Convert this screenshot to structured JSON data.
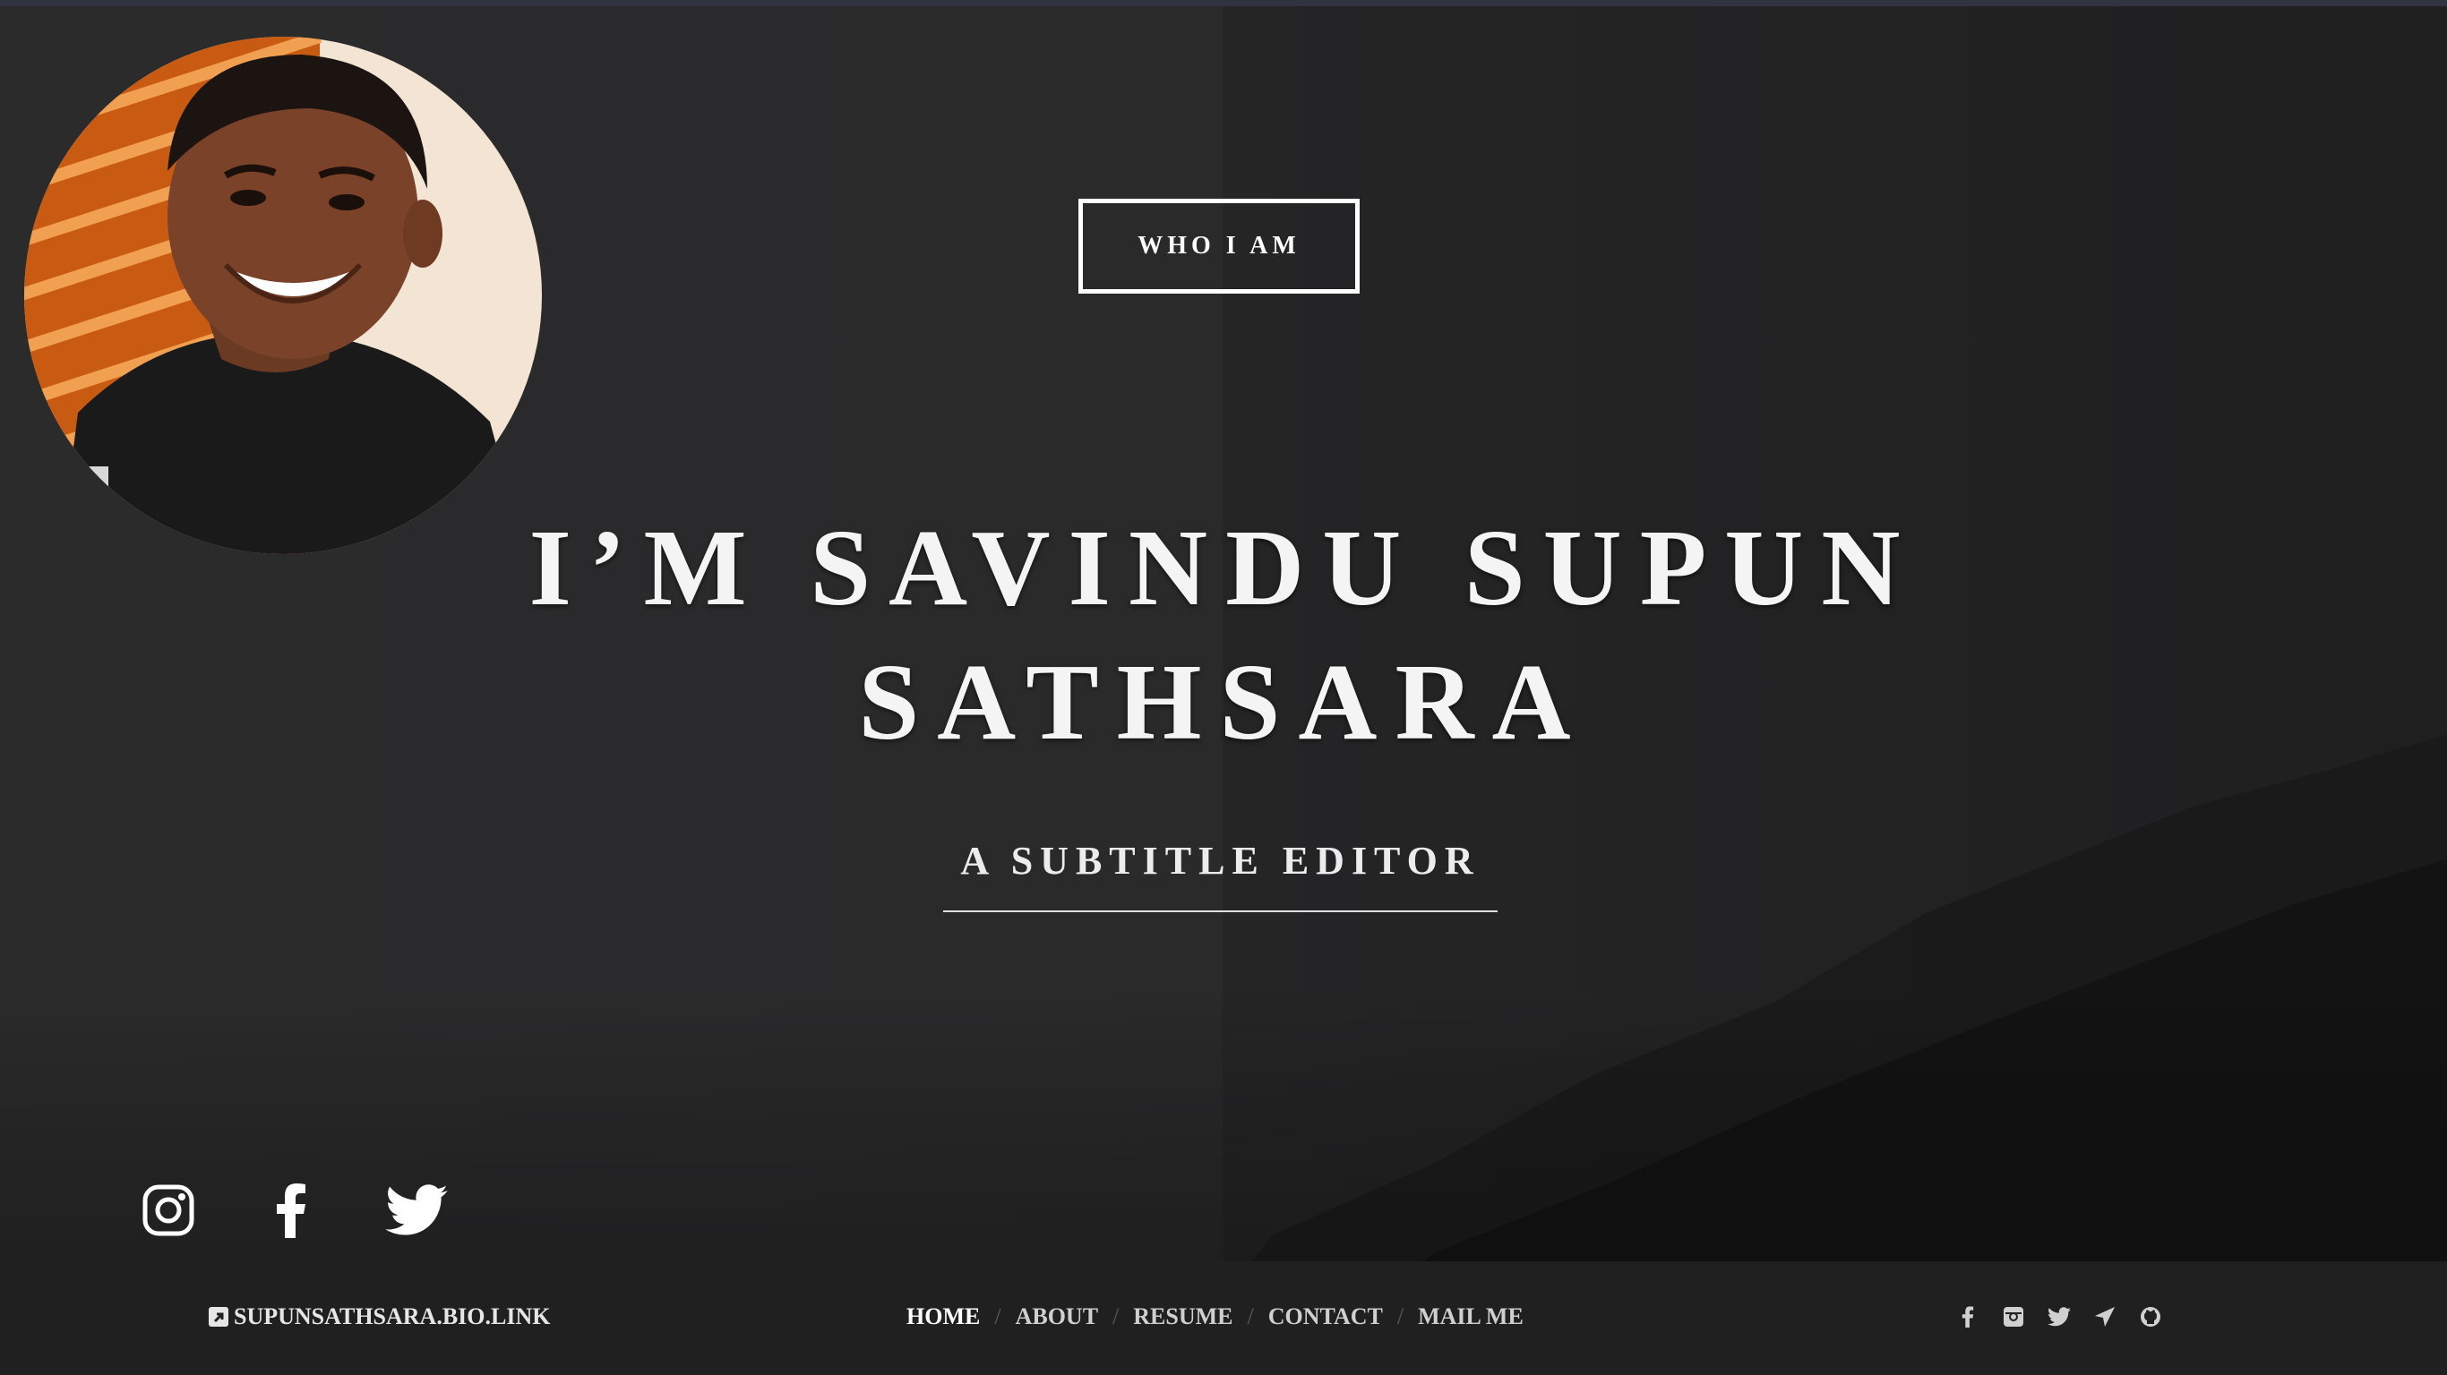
{
  "hero": {
    "who_button": "WHO I AM",
    "headline_line1": "I’M SAVINDU SUPUN",
    "headline_line2": "SATHSARA",
    "subtitle": "A SUBTITLE EDITOR"
  },
  "social": {
    "icons": [
      "instagram-icon",
      "facebook-icon",
      "twitter-icon"
    ]
  },
  "footer": {
    "brand": "SUPUNSATHSARA.BIO.LINK",
    "nav": [
      {
        "label": "HOME",
        "active": true
      },
      {
        "label": "ABOUT",
        "active": false
      },
      {
        "label": "RESUME",
        "active": false
      },
      {
        "label": "CONTACT",
        "active": false
      },
      {
        "label": "MAIL ME",
        "active": false
      }
    ],
    "icons": [
      "facebook-icon",
      "instagram-icon",
      "twitter-icon",
      "paper-plane-icon",
      "github-icon"
    ]
  },
  "colors": {
    "background": "#262626",
    "text": "#ffffff",
    "footer": "#202021"
  }
}
